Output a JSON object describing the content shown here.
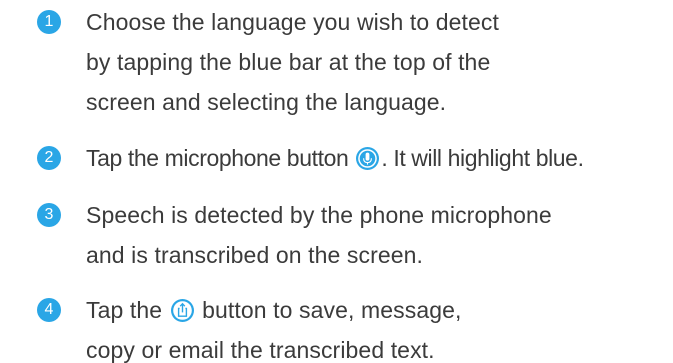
{
  "accent_color": "#2aa6e6",
  "steps": [
    {
      "number": "1",
      "lines": [
        "Choose the language you wish to detect",
        "by tapping the blue bar at the top of the",
        "screen and selecting the language."
      ]
    },
    {
      "number": "2",
      "before_icon": "Tap the microphone button ",
      "icon": "microphone-icon",
      "after_icon": ". It will highlight blue."
    },
    {
      "number": "3",
      "lines": [
        "Speech is detected by the phone microphone",
        "and is transcribed on the screen."
      ]
    },
    {
      "number": "4",
      "line1_before_icon": "Tap the ",
      "icon": "share-icon",
      "line1_after_icon": " button to save, message,",
      "line2": "copy or email the transcribed text."
    }
  ]
}
